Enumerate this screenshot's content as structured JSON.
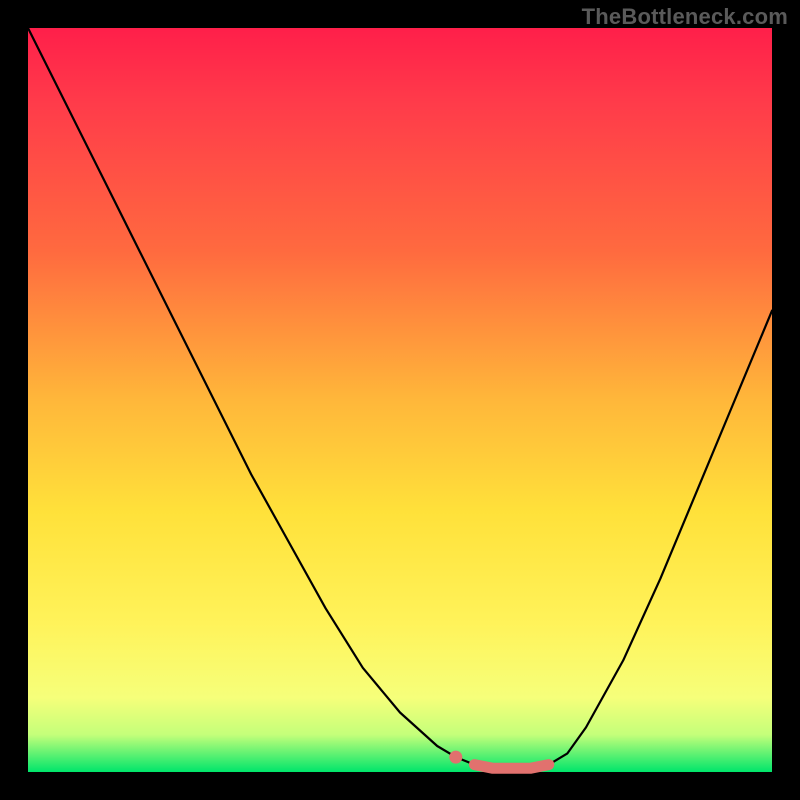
{
  "watermark": "TheBottleneck.com",
  "colors": {
    "curve": "#000000",
    "accent": "#e1716e",
    "background": "#000000",
    "gradient_top": "#ff1f4a",
    "gradient_bottom": "#00e56b"
  },
  "chart_data": {
    "type": "line",
    "title": "",
    "xlabel": "",
    "ylabel": "",
    "x": [
      0.0,
      0.05,
      0.1,
      0.15,
      0.2,
      0.25,
      0.3,
      0.35,
      0.4,
      0.45,
      0.5,
      0.55,
      0.575,
      0.6,
      0.625,
      0.65,
      0.675,
      0.7,
      0.725,
      0.75,
      0.8,
      0.85,
      0.9,
      0.95,
      1.0
    ],
    "values": [
      1.0,
      0.9,
      0.8,
      0.7,
      0.6,
      0.5,
      0.4,
      0.31,
      0.22,
      0.14,
      0.08,
      0.035,
      0.02,
      0.01,
      0.005,
      0.005,
      0.005,
      0.01,
      0.025,
      0.06,
      0.15,
      0.26,
      0.38,
      0.5,
      0.62
    ],
    "ylim": [
      0,
      1
    ],
    "xlim": [
      0,
      1
    ],
    "series": [
      {
        "name": "bottleneck-curve",
        "x": [
          0.0,
          0.05,
          0.1,
          0.15,
          0.2,
          0.25,
          0.3,
          0.35,
          0.4,
          0.45,
          0.5,
          0.55,
          0.575,
          0.6,
          0.625,
          0.65,
          0.675,
          0.7,
          0.725,
          0.75,
          0.8,
          0.85,
          0.9,
          0.95,
          1.0
        ],
        "y": [
          1.0,
          0.9,
          0.8,
          0.7,
          0.6,
          0.5,
          0.4,
          0.31,
          0.22,
          0.14,
          0.08,
          0.035,
          0.02,
          0.01,
          0.005,
          0.005,
          0.005,
          0.01,
          0.025,
          0.06,
          0.15,
          0.26,
          0.38,
          0.5,
          0.62
        ]
      }
    ],
    "accent_marker": {
      "x": 0.575,
      "y": 0.02
    },
    "accent_band": {
      "x0": 0.58,
      "x1": 0.72,
      "y0": 0.005,
      "y1": 0.03
    }
  }
}
